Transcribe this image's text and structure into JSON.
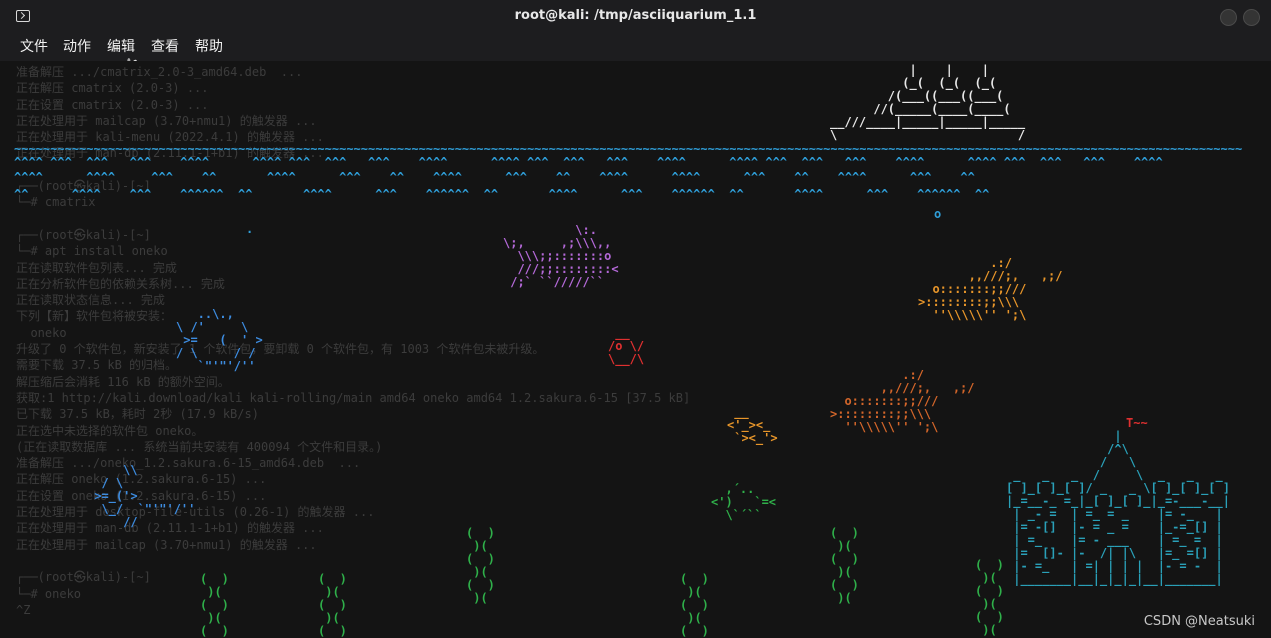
{
  "window": {
    "title": "root@kali: /tmp/asciiquarium_1.1",
    "icon": "terminal-icon",
    "buttons": [
      "minimize",
      "maximize",
      "close"
    ]
  },
  "menu": {
    "file": "文件",
    "action": "动作",
    "edit": "编辑",
    "view": "查看",
    "help": "帮助"
  },
  "terminal": {
    "background_text": "准备解压 .../cmatrix_2.0-3_amd64.deb  ...\n正在解压 cmatrix (2.0-3) ...\n正在设置 cmatrix (2.0-3) ...\n正在处理用于 mailcap (3.70+nmu1) 的触发器 ...\n正在处理用于 kali-menu (2022.4.1) 的触发器 ...\n正在处理用于 man-db (2.11.1-1+b1) 的触发器 ...\n\n┌──(root㉿kali)-[~]\n└─# cmatrix\n\n┌──(root㉿kali)-[~]\n└─# apt install oneko\n正在读取软件包列表... 完成\n正在分析软件包的依赖关系树... 完成\n正在读取状态信息... 完成\n下列【新】软件包将被安装：\n  oneko\n升级了 0 个软件包，新安装了 1 个软件包，要卸载 0 个软件包，有 1003 个软件包未被升级。\n需要下载 37.5 kB 的归档。\n解压缩后会消耗 116 kB 的额外空间。\n获取:1 http://kali.download/kali kali-rolling/main amd64 oneko amd64 1.2.sakura.6-15 [37.5 kB]\n已下载 37.5 kB，耗时 2秒 (17.9 kB/s)\n正在选中未选择的软件包 oneko。\n(正在读取数据库 ... 系统当前共安装有 400094 个文件和目录。)\n准备解压 .../oneko_1.2.sakura.6-15_amd64.deb  ...\n正在解压 oneko (1.2.sakura.6-15) ...\n正在设置 oneko (1.2.sakura.6-15) ...\n正在处理用于 desktop-file-utils (0.26-1) 的触发器 ...\n正在处理用于 man-db (2.11.1-1+b1) 的触发器 ...\n正在处理用于 mailcap (3.70+nmu1) 的触发器 ...\n\n┌──(root㉿kali)-[~]\n└─# oneko\n^Z"
  },
  "aquarium": {
    "ship": "           |    |    |\n          (_(  (_(  (_(\n        /(___((___((___(\n      //(_____(____(____(\n__///____|_____|_____|_____\n\\                         /",
    "waves_1": "~~~~~~~~~~~~~~~~~~~~~~~~~~~~~~~~~~~~~~~~~~~~~~~~~~~~~~~~~~~~~~~~~~~~~~~~~~~~~~~~~~~~~~~~~~~~~~~~~~~~~~~~~~~~~~~~~~~~~~~~~~~~~~~~~~~~~~~~~~~~~~~~~~~~~~~~~~~~~~~~~~~~~~~~~~",
    "waves_2": "^^^^ ^^^  ^^^   ^^^    ^^^^      ^^^^ ^^^  ^^^   ^^^    ^^^^      ^^^^ ^^^  ^^^   ^^^    ^^^^      ^^^^ ^^^  ^^^   ^^^    ^^^^      ^^^^ ^^^  ^^^   ^^^    ^^^^",
    "waves_3": "^^^^      ^^^^     ^^^    ^^       ^^^^      ^^^    ^^    ^^^^      ^^^    ^^    ^^^^      ^^^^      ^^^    ^^    ^^^^      ^^^    ^^",
    "waves_4": "^^      ^^^^    ^^^    ^^^^^^  ^^       ^^^^      ^^^    ^^^^^^  ^^       ^^^^      ^^^    ^^^^^^  ^^       ^^^^      ^^^    ^^^^^^  ^^",
    "bubble_1": "o",
    "bubble_2": ".",
    "whale_fish": "          \\:.\n\\;,     ,;\\\\\\,,\n  \\\\\\;;:::::::o\n  ///;;::::::::<\n /;` ``/////``",
    "fish_right_1": "          .:/\n       ,,///;,   ,;/\n  o:::::::;;///\n>::::::::;;\\\\\\\n  ''\\\\\\\\\\'' ';\\",
    "fish_right_2": "          .:/\n       ,,///;,   ,;/\n  o:::::::;;///\n>::::::::;;\\\\\\\n  ''\\\\\\\\\\'' ';\\",
    "small_fish_1": " __\n<'_><_\n `><_'>",
    "small_fish_2": "  ,´..\n<')   `=<\n  \\`´``",
    "small_fish_3": " __\n/o \\/\n\\__/\\",
    "big_fish_left": "   ..\\.,\n\\ /'     \\\n >=   (  ' >\n/ \\     / /\n   `\"'\"'/''",
    "big_fish_left_2": "     \\\\\n  / \\\n >=_('>\n  \\_/  `\"'\"'/''\n     //",
    "castle_flag": "T~~",
    "castle": "               |\n              /^\\\n             /   \\\n _   _   _  /     \\  _   _   _\n[ ]_[ ]_[ ]/ _   _ \\[ ]_[ ]_[ ]\n|_=__-_ =_|_[ ]_[ ]_|_=-___-__|\n | _- =  | =_ = _    |= -_   |\n |= -[]  |- = _ =    |_-=_[] |\n | =_    |= - ___    | =_ =  |\n |=  []- |-  /| |\\   |=_ =[] |\n |- =_   | =| | | |  |- = -  |\n |_______|__|_|_|_|__|_______|",
    "seaweed": "(  )\n )(\n(  )\n )(\n(  )\n )("
  },
  "watermark": "CSDN @Neatsuki",
  "colors": {
    "title_bar": "#1d1d1f",
    "terminal_bg": "#141414",
    "wave": "#2f9ed8",
    "ship": "#e8e8e8",
    "ship_mast": "#e0a030",
    "fish_orange": "#e8962a",
    "fish_purple": "#9b5fc8",
    "fish_blue": "#3d8ce0",
    "fish_red": "#e03030",
    "castle": "#2aa0b8",
    "seaweed": "#2fb04a"
  }
}
